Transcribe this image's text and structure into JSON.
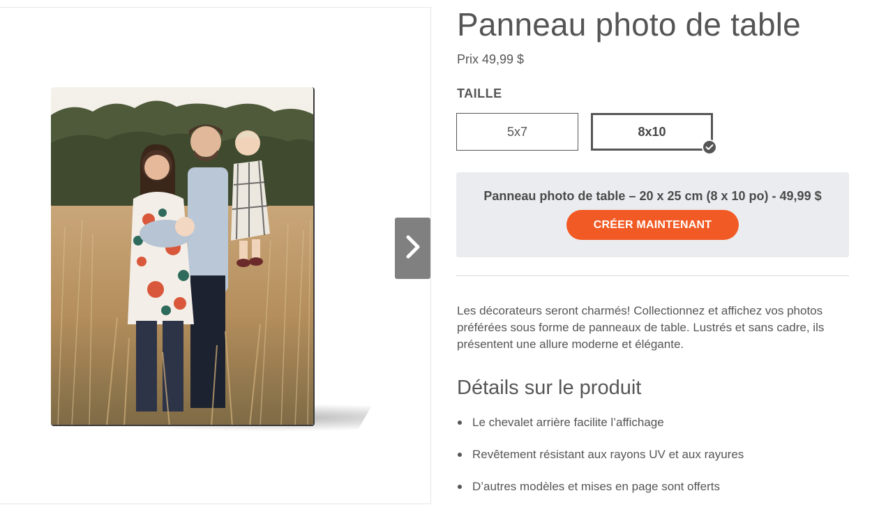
{
  "product": {
    "title": "Panneau photo de table",
    "price": "Prix 49,99 $"
  },
  "size": {
    "label": "TAILLE",
    "options": [
      {
        "label": "5x7",
        "selected": false
      },
      {
        "label": "8x10",
        "selected": true
      }
    ]
  },
  "cta": {
    "description": "Panneau photo de table – 20 x 25 cm (8 x 10 po) - 49,99 $",
    "button_label": "CRÉER MAINTENANT"
  },
  "description": "Les décorateurs seront charmés! Collectionnez et affichez vos photos préférées sous forme de panneaux de table. Lustrés et sans cadre, ils présentent une allure moderne et élégante.",
  "details": {
    "title": "Détails sur le produit",
    "items": [
      "Le chevalet arrière facilite l’affichage",
      "Revêtement résistant aux rayons UV et aux rayures",
      "D’autres modèles et mises en page sont offerts"
    ]
  },
  "icons": {
    "gallery_next": "chevron-right-icon",
    "selected": "check-icon"
  },
  "colors": {
    "accent": "#f15a24",
    "cta_background": "#ebecef",
    "text": "#555555",
    "arrow_background": "#808080"
  }
}
